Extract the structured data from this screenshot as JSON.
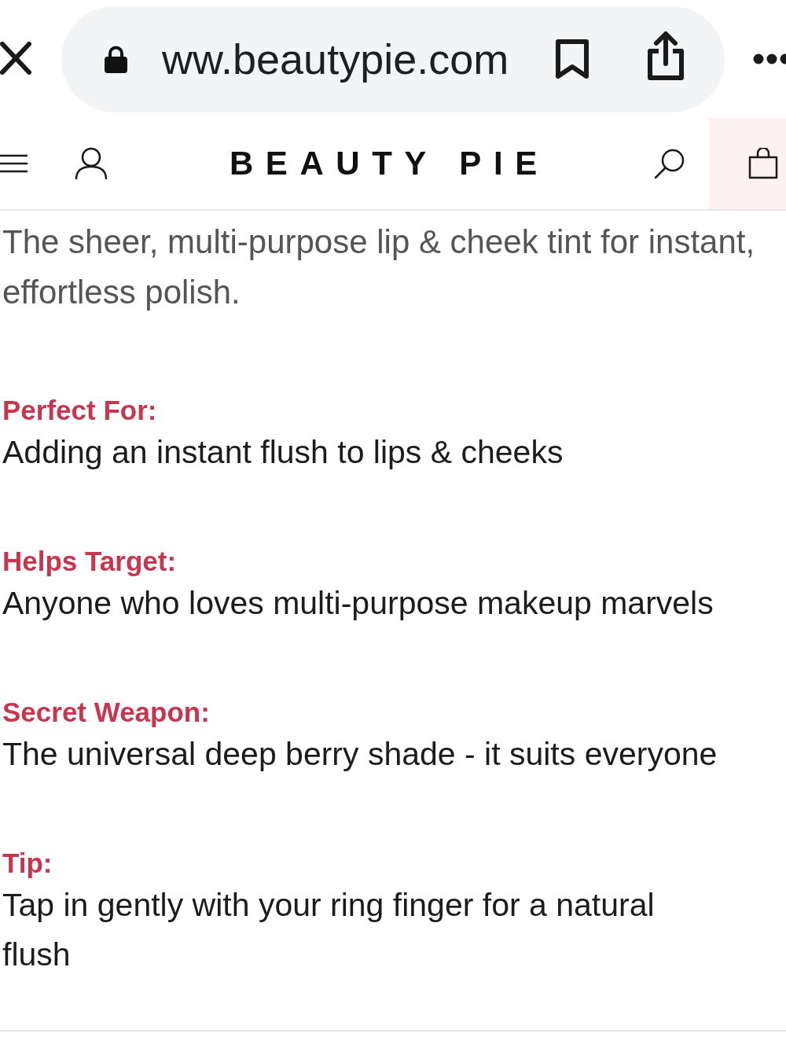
{
  "browser_bar": {
    "url": "ww.beautypie.com"
  },
  "site_header": {
    "logo": "BEAUTY PIE"
  },
  "product_details": {
    "intro": "The sheer, multi-purpose lip & cheek tint for instant, effortless polish.",
    "sections": [
      {
        "label": "Perfect For:",
        "text": "Adding an instant flush to lips & cheeks"
      },
      {
        "label": "Helps Target:",
        "text": "Anyone who loves multi-purpose makeup marvels"
      },
      {
        "label": "Secret Weapon:",
        "text": "The universal deep berry shade - it suits everyone"
      },
      {
        "label": "Tip:",
        "text": "Tap in gently with your ring finger for a natural flush"
      }
    ]
  }
}
